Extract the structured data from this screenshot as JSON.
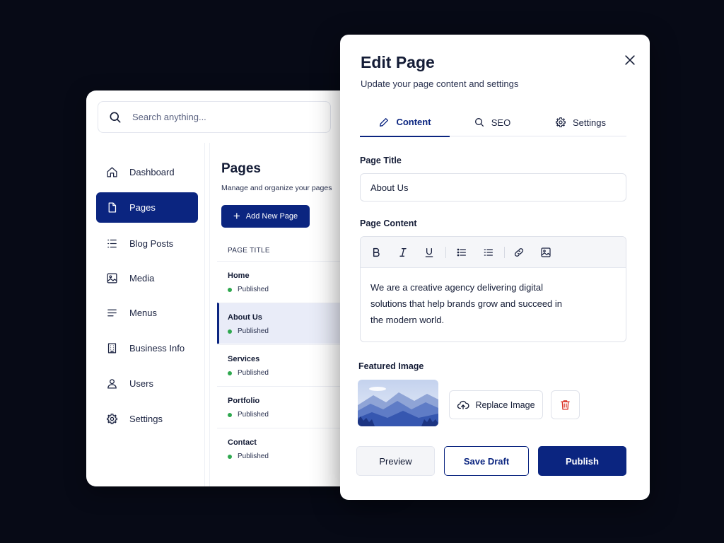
{
  "colors": {
    "accent": "#0b2580",
    "published": "#2fa84f",
    "danger": "#d92d20",
    "background": "#070a16"
  },
  "search": {
    "placeholder": "Search anything..."
  },
  "sidebar": {
    "items": [
      {
        "label": "Dashboard",
        "icon": "home-icon"
      },
      {
        "label": "Pages",
        "icon": "file-icon",
        "active": true
      },
      {
        "label": "Blog Posts",
        "icon": "list-icon"
      },
      {
        "label": "Media",
        "icon": "image-icon"
      },
      {
        "label": "Menus",
        "icon": "menu-icon"
      },
      {
        "label": "Business Info",
        "icon": "building-icon"
      },
      {
        "label": "Users",
        "icon": "user-icon"
      },
      {
        "label": "Settings",
        "icon": "gear-icon"
      }
    ]
  },
  "pages": {
    "title": "Pages",
    "subtitle": "Manage and organize your pages",
    "add_label": "Add New Page",
    "column_header": "PAGE TITLE",
    "rows": [
      {
        "title": "Home",
        "status": "Published"
      },
      {
        "title": "About Us",
        "status": "Published",
        "selected": true
      },
      {
        "title": "Services",
        "status": "Published"
      },
      {
        "title": "Portfolio",
        "status": "Published"
      },
      {
        "title": "Contact",
        "status": "Published"
      }
    ]
  },
  "modal": {
    "title": "Edit Page",
    "subtitle": "Update your page content and settings",
    "tabs": [
      {
        "label": "Content",
        "icon": "pencil-icon",
        "active": true
      },
      {
        "label": "SEO",
        "icon": "search-icon"
      },
      {
        "label": "Settings",
        "icon": "gear-icon"
      }
    ],
    "page_title_label": "Page Title",
    "page_title_value": "About Us",
    "content_label": "Page Content",
    "content_text": "We are a creative agency delivering digital solutions that help brands grow and succeed in the modern world.",
    "featured_label": "Featured Image",
    "replace_label": "Replace Image",
    "preview_label": "Preview",
    "draft_label": "Save Draft",
    "publish_label": "Publish"
  }
}
